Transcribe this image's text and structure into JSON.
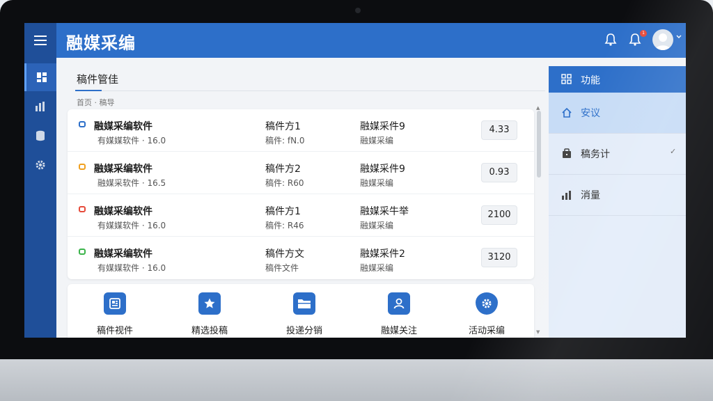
{
  "app": {
    "title": "融媒采编"
  },
  "header": {
    "notification_badge": "1"
  },
  "page": {
    "title": "稿件管佳",
    "breadcrumb": "首页 · 稿导"
  },
  "list": {
    "rows": [
      {
        "icon_color": "#2d6fc9",
        "name": "融媒采编软件",
        "sub": "有媒媒软件 · 16.0",
        "col2": "稿件方1",
        "col2_sub": "稿件: fN.0",
        "col3": "融媒采件9",
        "col3_sub": "融媒采编",
        "value": "4.33"
      },
      {
        "icon_color": "#f0a020",
        "name": "融媒采编软件",
        "sub": "融媒采软件 · 16.5",
        "col2": "稿件方2",
        "col2_sub": "稿件: R60",
        "col3": "融媒采件9",
        "col3_sub": "融媒采编",
        "value": "0.93"
      },
      {
        "icon_color": "#e64b3b",
        "name": "融媒采编软件",
        "sub": "有媒媒软件 · 16.0",
        "col2": "稿件方1",
        "col2_sub": "稿件: R46",
        "col3": "融媒采牛举",
        "col3_sub": "融媒采编",
        "value": "2100"
      },
      {
        "icon_color": "#3cb44b",
        "name": "融媒采编软件",
        "sub": "有媒媒软件 · 16.0",
        "col2": "稿件方文",
        "col2_sub": "稿件文件",
        "col3": "融媒采件2",
        "col3_sub": "融媒采编",
        "value": "3120"
      }
    ]
  },
  "actions": [
    {
      "icon": "news-icon",
      "label": "稿件视件"
    },
    {
      "icon": "star-icon",
      "label": "精选投稿"
    },
    {
      "icon": "folder-icon",
      "label": "投递分销"
    },
    {
      "icon": "user-icon",
      "label": "融媒关注"
    },
    {
      "icon": "settings-icon",
      "label": "活动采编"
    }
  ],
  "right_panel": {
    "header": "功能",
    "items": [
      {
        "icon": "home-icon",
        "label": "安议"
      },
      {
        "icon": "task-icon",
        "label": "稿务计"
      },
      {
        "icon": "chart-icon",
        "label": "消量"
      }
    ]
  },
  "colors": {
    "primary": "#2d6fc9",
    "sidebar": "#1f4f99",
    "panel": "#e3ecf9"
  }
}
